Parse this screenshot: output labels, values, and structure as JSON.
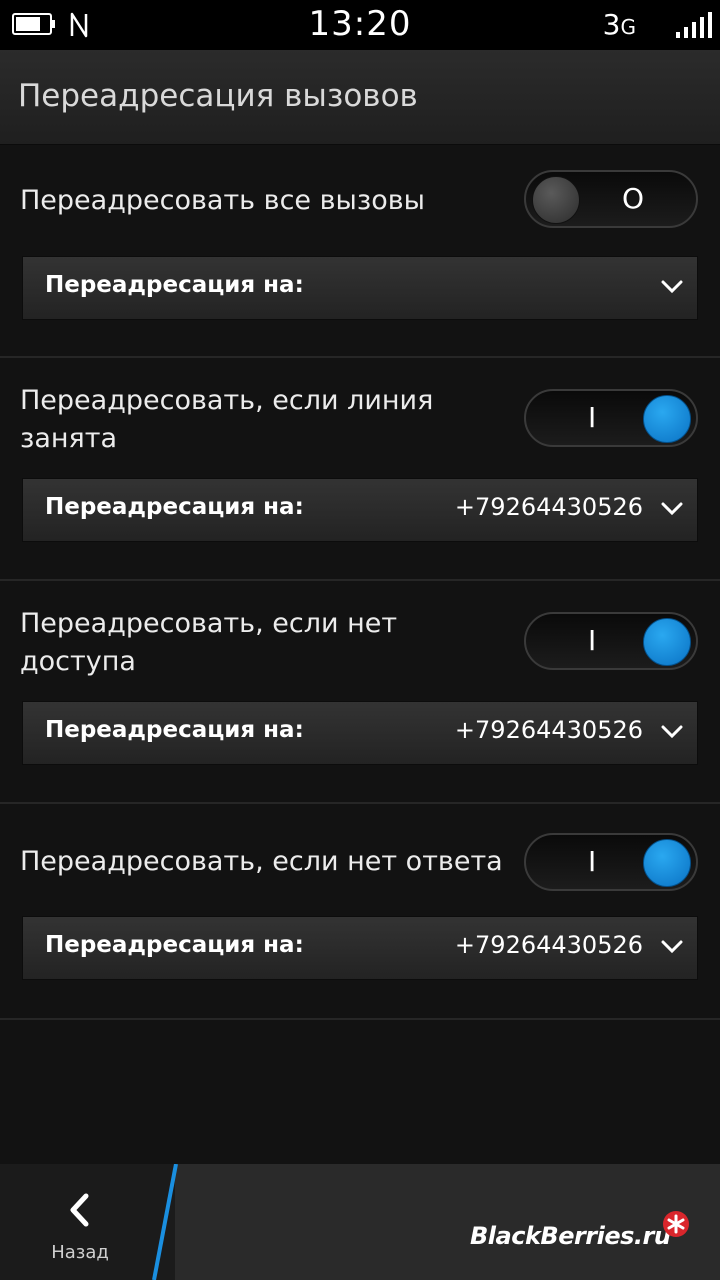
{
  "status": {
    "time": "13:20",
    "network": "3G",
    "network_main": "3",
    "network_sub": "G"
  },
  "header": {
    "title": "Переадресация вызовов"
  },
  "sections": [
    {
      "label": "Переадресовать все вызовы",
      "toggle": "off",
      "toggle_mark": "O",
      "forward_label": "Переадресация на:",
      "forward_value": ""
    },
    {
      "label": "Переадресовать, если линия занята",
      "toggle": "on",
      "toggle_mark": "I",
      "forward_label": "Переадресация на:",
      "forward_value": "+79264430526"
    },
    {
      "label": "Переадресовать, если нет доступа",
      "toggle": "on",
      "toggle_mark": "I",
      "forward_label": "Переадресация на:",
      "forward_value": "+79264430526"
    },
    {
      "label": "Переадресовать, если нет ответа",
      "toggle": "on",
      "toggle_mark": "I",
      "forward_label": "Переадресация на:",
      "forward_value": "+79264430526"
    }
  ],
  "actionbar": {
    "back_label": "Назад",
    "brand": "BlackBerries.ru"
  },
  "colors": {
    "accent": "#1a8fe0",
    "background": "#121212"
  }
}
